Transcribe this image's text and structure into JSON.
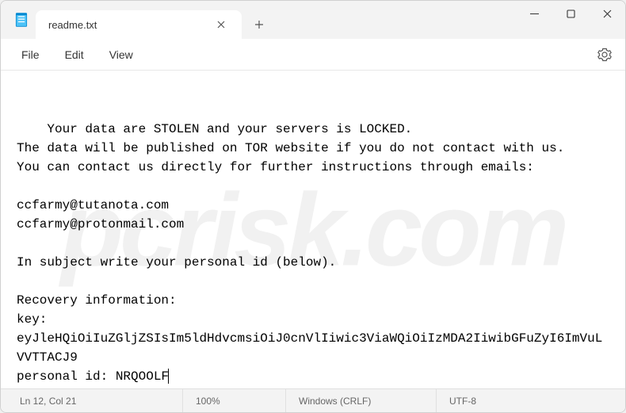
{
  "tab": {
    "title": "readme.txt"
  },
  "menu": {
    "file": "File",
    "edit": "Edit",
    "view": "View"
  },
  "document": {
    "body": "Your data are STOLEN and your servers is LOCKED.\nThe data will be published on TOR website if you do not contact with us.\nYou can contact us directly for further instructions through emails:\n\nccfarmy@tutanota.com\nccfarmy@protonmail.com\n\nIn subject write your personal id (below).\n\nRecovery information:\nkey: eyJleHQiOiIuZGljZSIsIm5ldHdvcmsiOiJ0cnVlIiwic3ViaWQiOiIzMDA2IiwibGFuZyI6ImVuLVVTTACJ9\npersonal id: NRQOOLF"
  },
  "status": {
    "position": "Ln 12, Col 21",
    "zoom": "100%",
    "lineEnding": "Windows (CRLF)",
    "encoding": "UTF-8"
  },
  "watermark": "pcrisk.com"
}
